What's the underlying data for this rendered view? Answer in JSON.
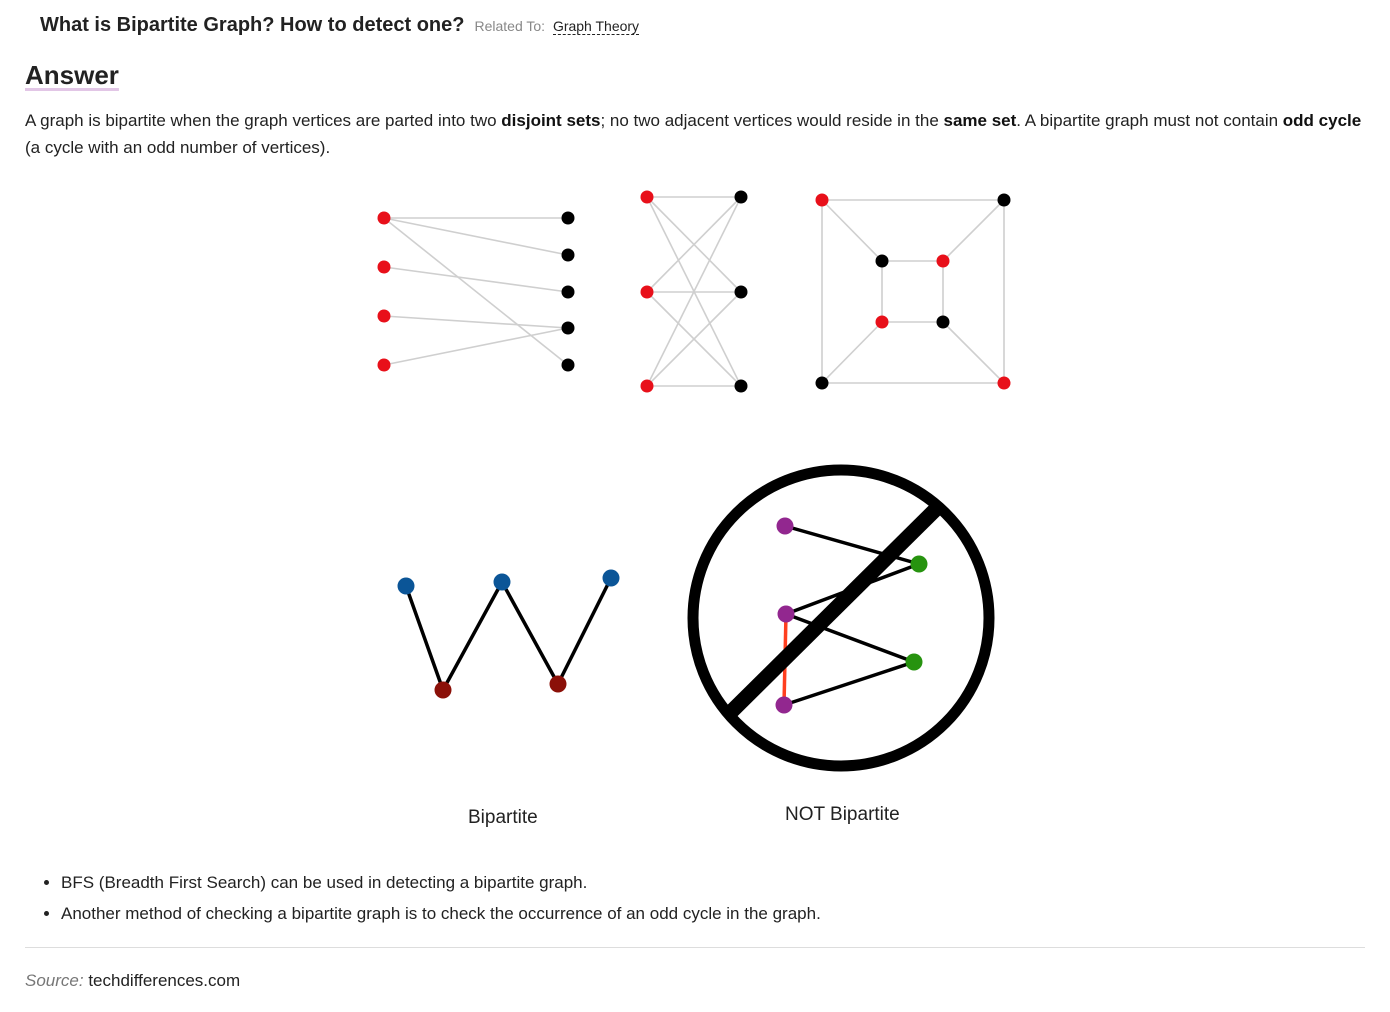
{
  "question": {
    "title": "What is Bipartite Graph? How to detect one?",
    "related_prefix": "Related To:",
    "related_topic": "Graph Theory"
  },
  "answer": {
    "heading": "Answer",
    "parts": [
      "A graph is bipartite when the graph vertices are parted into two ",
      "disjoint sets",
      "; no two adjacent vertices would reside in the ",
      "same set",
      ". A bipartite graph must not contain ",
      "odd cycle",
      " (a cycle with an odd number of vertices)."
    ]
  },
  "figure": {
    "caption_left": "Bipartite",
    "caption_right": "NOT Bipartite",
    "colors": {
      "set_a": "#e8101a",
      "set_b": "#000000",
      "edge_light": "#cfcfcf",
      "blue_node": "#0b5597",
      "dark_red_node": "#8b1008",
      "purple_node": "#92278f",
      "green_node": "#27930f",
      "odd_edge": "#ff3f1f"
    }
  },
  "bullets": [
    "BFS (Breadth First Search) can be used in detecting a bipartite graph.",
    "Another method of checking a bipartite graph is to check the occurrence of an odd cycle in the graph."
  ],
  "source": {
    "label": "Source:",
    "site": "techdifferences.com"
  }
}
